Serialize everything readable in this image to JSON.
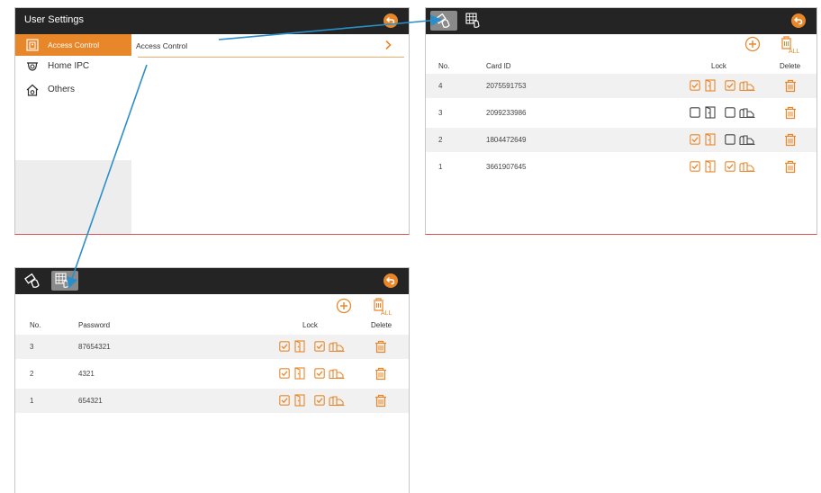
{
  "user_settings": {
    "title": "User Settings",
    "sidebar": [
      {
        "label": "Access Control",
        "icon": "access-control-icon",
        "active": true
      },
      {
        "label": "Home IPC",
        "icon": "ipc-camera-icon",
        "active": false
      },
      {
        "label": "Others",
        "icon": "house-gear-icon",
        "active": false
      }
    ],
    "main_item": "Access Control"
  },
  "card_panel": {
    "headers": {
      "no": "No.",
      "id": "Card ID",
      "lock": "Lock",
      "delete": "Delete"
    },
    "rows": [
      {
        "no": "4",
        "id": "2075591753",
        "lock1": true,
        "lock2": true
      },
      {
        "no": "3",
        "id": "2099233986",
        "lock1": false,
        "lock2": false
      },
      {
        "no": "2",
        "id": "1804472649",
        "lock1": true,
        "lock2": false
      },
      {
        "no": "1",
        "id": "3661907645",
        "lock1": true,
        "lock2": true
      }
    ]
  },
  "password_panel": {
    "headers": {
      "no": "No.",
      "id": "Password",
      "lock": "Lock",
      "delete": "Delete"
    },
    "rows": [
      {
        "no": "3",
        "id": "87654321",
        "lock1": true,
        "lock2": true
      },
      {
        "no": "2",
        "id": "4321",
        "lock1": true,
        "lock2": true
      },
      {
        "no": "1",
        "id": "654321",
        "lock1": true,
        "lock2": true
      }
    ]
  },
  "colors": {
    "accent": "#e8872a",
    "topbar": "#242424",
    "arrow": "#2a8fc9"
  }
}
